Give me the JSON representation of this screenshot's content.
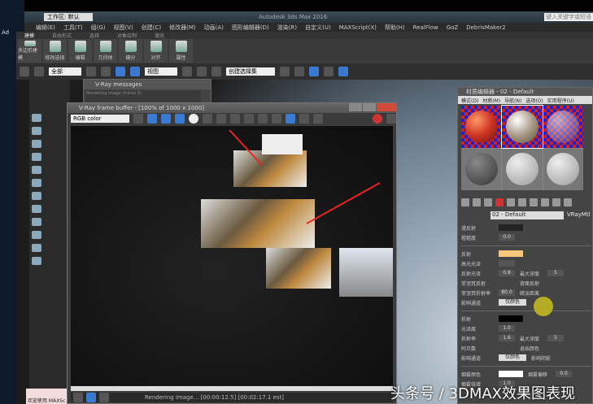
{
  "desktop": {
    "label": "Ad"
  },
  "titlebar": {
    "workspace": "工作区: 默认",
    "title": "Autodesk 3ds Max 2016",
    "search_placeholder": "键入关键字或短语"
  },
  "menubar": [
    "编辑(E)",
    "工具(T)",
    "组(G)",
    "视图(V)",
    "创建(C)",
    "修改器(M)",
    "动画(A)",
    "图形编辑器(D)",
    "渲染(R)",
    "自定义(U)",
    "MAXScript(X)",
    "帮助(H)",
    "RealFlow",
    "GoZ",
    "DebrisMaker2"
  ],
  "ribbon_tabs": [
    "建模",
    "自由形式",
    "选择",
    "对象绘制",
    "填充"
  ],
  "ribbon_buttons": [
    "多边形建模",
    "修改选择",
    "编辑",
    "几何体",
    "细分",
    "对齐",
    "属性"
  ],
  "toolbar": {
    "selection_filter": "全部",
    "view": "视图",
    "named_selection": "创建选择集"
  },
  "vray_messages": {
    "title": "V-Ray messages",
    "text": "Rendering image (frame 0)"
  },
  "vfb": {
    "title": "V-Ray frame buffer - [100% of 1000 x 1000]",
    "channel": "RGB color",
    "status": "Rendering image... [00:00:12.5] [00:02:17.1 est]"
  },
  "welcome": "欢迎使用 MAXSc",
  "material_editor": {
    "title": "材质编辑器 - 02 - Default",
    "menu": [
      "模式(D)",
      "材质(M)",
      "导航(N)",
      "选项(O)",
      "实用程序(U)"
    ],
    "material_name": "02 - Default",
    "material_type": "VRayMtl",
    "params": {
      "diffuse": "漫反射",
      "roughness": "粗糙度",
      "roughness_val": "0.0",
      "reflect": "反射",
      "hilight_gloss": "高光光泽",
      "refl_gloss": "反射光泽",
      "refl_gloss_val": "0.8",
      "fresnel": "菲涅耳反射",
      "fresnel_ior": "菲涅耳折射率",
      "fresnel_ior_val": "80.0",
      "affect_channels": "影响通道",
      "only_color": "仅颜色",
      "max_depth": "最大深度",
      "max_depth_val": "5",
      "back_reflect": "背面反射",
      "dim_distance": "暗淡距离",
      "refract": "折射",
      "glossiness": "光泽度",
      "glossiness_val": "1.0",
      "ior": "折射率",
      "ior_val": "1.6",
      "abbe": "阿贝数",
      "refr_max_depth_val": "5",
      "exit_color": "退出颜色",
      "affect_shadows": "影响阴影",
      "fog_color": "烟雾颜色",
      "fog_mult": "烟雾倍增",
      "fog_mult_val": "1.0",
      "fog_bias": "烟雾偏移",
      "fog_bias_val": "0.0"
    },
    "reflect_color": "#f7c77a",
    "refract_color": "#000000",
    "fog_color_val": "#ffffff"
  },
  "watermark": "头条号 / 3DMAX效果图表现"
}
